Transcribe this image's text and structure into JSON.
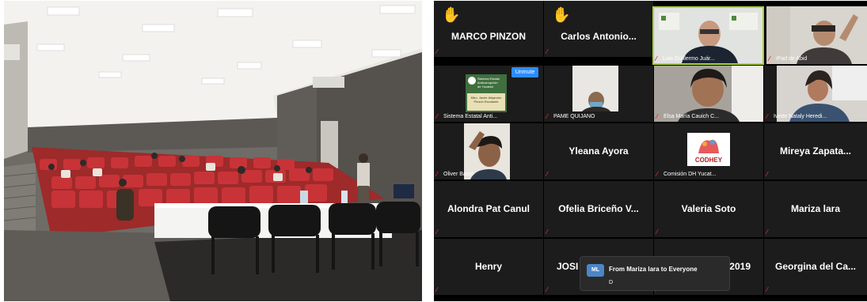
{
  "photo": {
    "alt": "auditorium-photo"
  },
  "gallery": {
    "tiles": [
      {
        "name": "MARCO PINZON",
        "caption": "",
        "hand": true
      },
      {
        "name": "Carlos Antonio...",
        "caption": "",
        "hand": true
      },
      {
        "name": "",
        "caption": "Luis Guillermo Juár...",
        "hand": false
      },
      {
        "name": "",
        "caption": "iPad de Abid",
        "hand": false
      },
      {
        "name": "",
        "caption": "Sistema Estatal Anti...",
        "hand": false
      },
      {
        "name": "",
        "caption": "PAME QUIJANO",
        "hand": false
      },
      {
        "name": "",
        "caption": "Elsa María Cauich C...",
        "hand": false
      },
      {
        "name": "",
        "caption": "Ivette Nataly Heredi...",
        "hand": false
      },
      {
        "name": "",
        "caption": "Oliver Basto",
        "hand": false
      },
      {
        "name": "Yleana Ayora",
        "caption": "",
        "hand": false
      },
      {
        "name": "",
        "caption": "Comisión DH Yucat...",
        "hand": false
      },
      {
        "name": "Mireya  Zapata...",
        "caption": "",
        "hand": false
      },
      {
        "name": "Alondra Pat Canul",
        "caption": "",
        "hand": false
      },
      {
        "name": "Ofelia  Briceño  V...",
        "caption": "",
        "hand": false
      },
      {
        "name": "Valeria Soto",
        "caption": "",
        "hand": false
      },
      {
        "name": "Mariza lara",
        "caption": "",
        "hand": false
      },
      {
        "name": "Henry",
        "caption": "",
        "hand": false
      },
      {
        "name": "JOSI",
        "caption": "",
        "hand": false
      },
      {
        "name": "Y7 2019",
        "caption": "",
        "hand": false
      },
      {
        "name": "Georgina del Ca...",
        "caption": "",
        "hand": false
      }
    ],
    "unmute_label": "Unmute",
    "logo_text": "CODHEY",
    "sistema_logo_lines": [
      "Sistema Estatal",
      "Anticorrupción",
      "de Yucatán"
    ],
    "sistema_sign_text": "Mtro. Javier Alejandro Pinzón Escalante",
    "mic_icon": "mic-muted-icon",
    "accent": "#a8d33a"
  },
  "chat_popup": {
    "avatar": "ML",
    "from": "From Mariza lara to Everyone",
    "message": "D"
  }
}
